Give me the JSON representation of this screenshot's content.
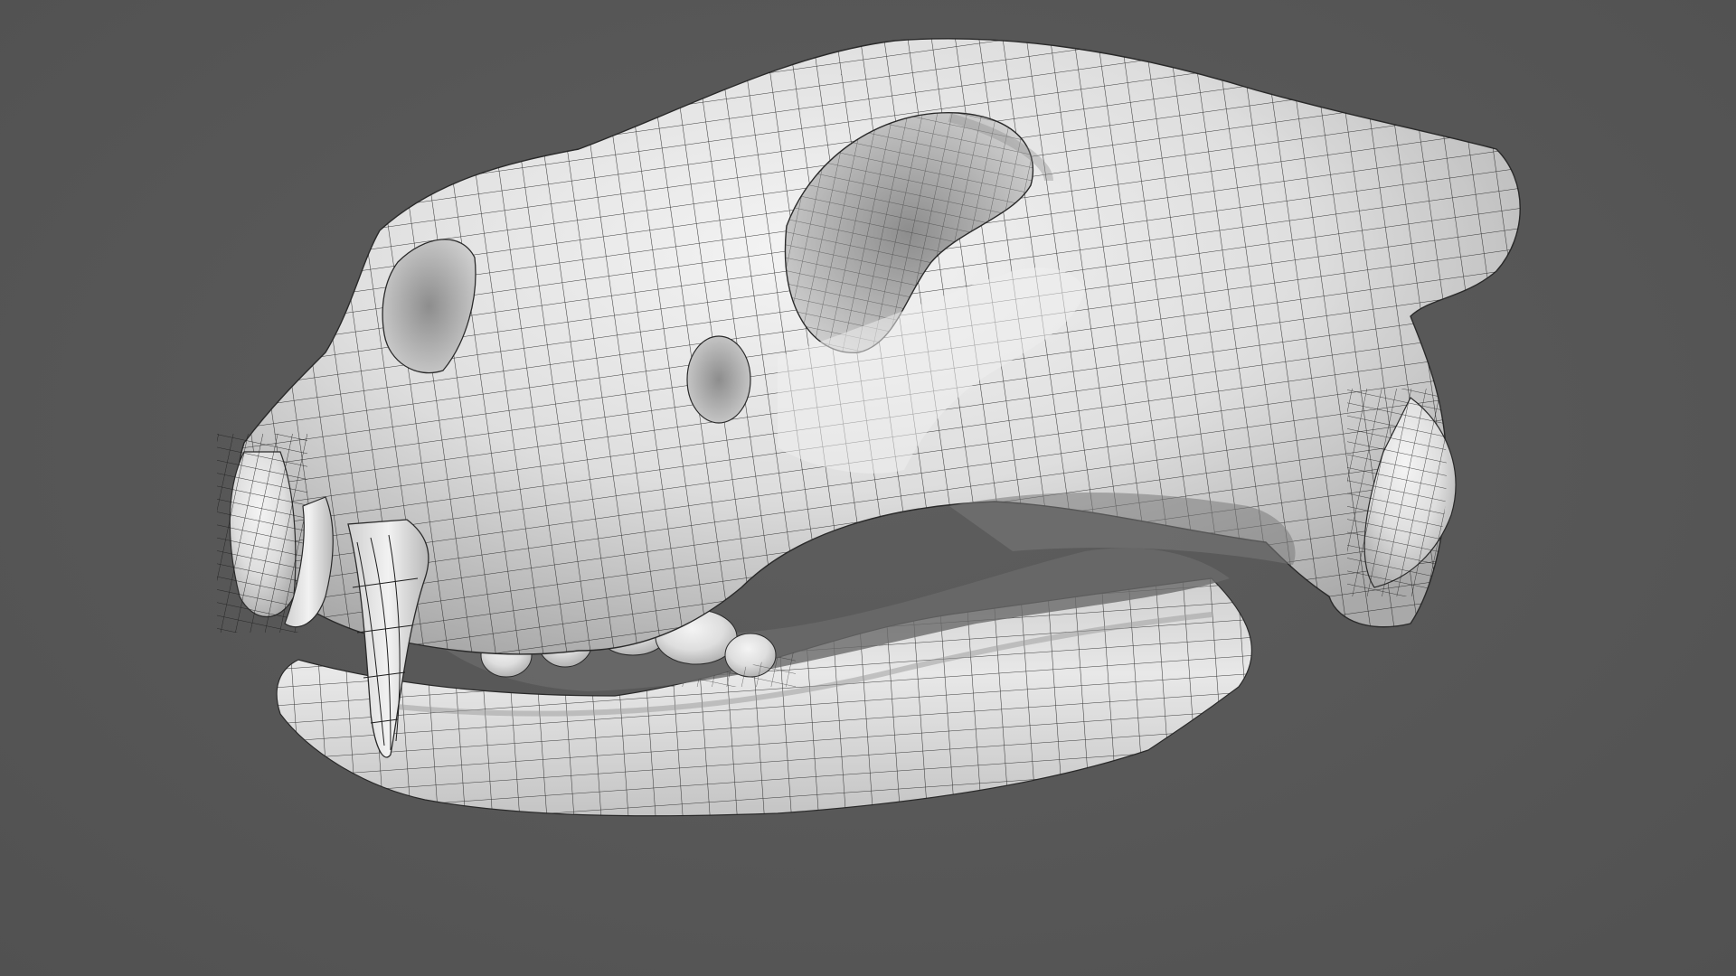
{
  "viewport": {
    "background_color": "#575757",
    "subject": "skull-mesh-icon",
    "mesh_fill_color": "#e6e6e6",
    "wire_color": "#1e1e1e"
  }
}
